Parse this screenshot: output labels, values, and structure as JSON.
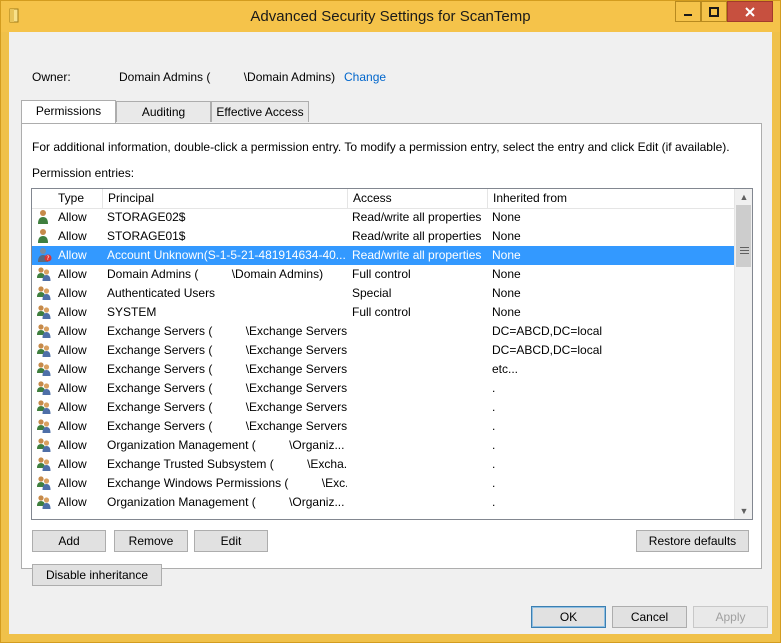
{
  "window": {
    "title": "Advanced Security Settings for ScanTemp"
  },
  "owner": {
    "label": "Owner:",
    "value": "Domain Admins (          \\Domain Admins)",
    "change_link": "Change"
  },
  "tabs": [
    {
      "label": "Permissions",
      "active": true
    },
    {
      "label": "Auditing",
      "active": false
    },
    {
      "label": "Effective Access",
      "active": false
    }
  ],
  "info_text": "For additional information, double-click a permission entry. To modify a permission entry, select the entry and click Edit (if available).",
  "entries_label": "Permission entries:",
  "columns": {
    "type": "Type",
    "principal": "Principal",
    "access": "Access",
    "inherited": "Inherited from"
  },
  "rows": [
    {
      "icon": "user-icon",
      "type": "Allow",
      "principal": "STORAGE02$",
      "access": "Read/write all properties",
      "inherited": "None"
    },
    {
      "icon": "user-icon",
      "type": "Allow",
      "principal": "STORAGE01$",
      "access": "Read/write all properties",
      "inherited": "None"
    },
    {
      "icon": "unknown-user-icon",
      "type": "Allow",
      "principal": "Account Unknown(S-1-5-21-481914634-40...",
      "access": "Read/write all properties",
      "inherited": "None",
      "selected": true
    },
    {
      "icon": "group-icon",
      "type": "Allow",
      "principal": "Domain Admins (          \\Domain Admins)",
      "access": "Full control",
      "inherited": "None"
    },
    {
      "icon": "group-icon",
      "type": "Allow",
      "principal": "Authenticated Users",
      "access": "Special",
      "inherited": "None"
    },
    {
      "icon": "group-icon",
      "type": "Allow",
      "principal": "SYSTEM",
      "access": "Full control",
      "inherited": "None"
    },
    {
      "icon": "group-icon",
      "type": "Allow",
      "principal": "Exchange Servers (          \\Exchange Servers)",
      "access": "",
      "inherited": "DC=ABCD,DC=local"
    },
    {
      "icon": "group-icon",
      "type": "Allow",
      "principal": "Exchange Servers (          \\Exchange Servers)",
      "access": "",
      "inherited": "DC=ABCD,DC=local"
    },
    {
      "icon": "group-icon",
      "type": "Allow",
      "principal": "Exchange Servers (          \\Exchange Servers)",
      "access": "",
      "inherited": "etc..."
    },
    {
      "icon": "group-icon",
      "type": "Allow",
      "principal": "Exchange Servers (          \\Exchange Servers)",
      "access": "",
      "inherited": "."
    },
    {
      "icon": "group-icon",
      "type": "Allow",
      "principal": "Exchange Servers (          \\Exchange Servers)",
      "access": "",
      "inherited": "."
    },
    {
      "icon": "group-icon",
      "type": "Allow",
      "principal": "Exchange Servers (          \\Exchange Servers)",
      "access": "",
      "inherited": "."
    },
    {
      "icon": "group-icon",
      "type": "Allow",
      "principal": "Organization Management (          \\Organiz...",
      "access": "",
      "inherited": "."
    },
    {
      "icon": "group-icon",
      "type": "Allow",
      "principal": "Exchange Trusted Subsystem (          \\Excha...",
      "access": "",
      "inherited": "."
    },
    {
      "icon": "group-icon",
      "type": "Allow",
      "principal": "Exchange Windows Permissions (          \\Exc...",
      "access": "",
      "inherited": "."
    },
    {
      "icon": "group-icon",
      "type": "Allow",
      "principal": "Organization Management (          \\Organiz...",
      "access": "",
      "inherited": "."
    }
  ],
  "buttons": {
    "add": "Add",
    "remove": "Remove",
    "edit": "Edit",
    "restore_defaults": "Restore defaults",
    "disable_inheritance": "Disable inheritance",
    "ok": "OK",
    "cancel": "Cancel",
    "apply": "Apply"
  },
  "colors": {
    "titlebar": "#f5c34a",
    "selection": "#3399ff",
    "close_button": "#c7503f",
    "link": "#0066cc"
  }
}
